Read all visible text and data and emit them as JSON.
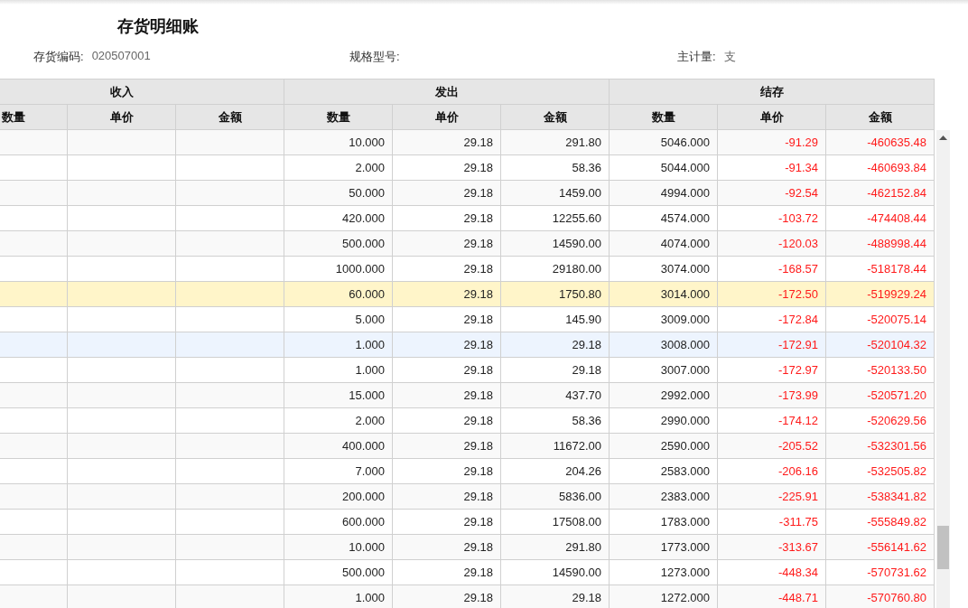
{
  "title": "存货明细账",
  "info": [
    {
      "label": "存货编码:",
      "value": "020507001"
    },
    {
      "label": "规格型号:"
    },
    {
      "label": "主计量:",
      "value": "支"
    }
  ],
  "groups": [
    "收入",
    "发出",
    "结存"
  ],
  "columns": [
    "数量",
    "单价",
    "金额",
    "数量",
    "单价",
    "金额",
    "数量",
    "单价",
    "金额"
  ],
  "rows": [
    {
      "issue": [
        "10.000",
        "29.18",
        "291.80"
      ],
      "balance": [
        "5046.000",
        "-91.29",
        "-460635.48"
      ],
      "selected": false,
      "hovered": false
    },
    {
      "issue": [
        "2.000",
        "29.18",
        "58.36"
      ],
      "balance": [
        "5044.000",
        "-91.34",
        "-460693.84"
      ],
      "selected": false,
      "hovered": false
    },
    {
      "issue": [
        "50.000",
        "29.18",
        "1459.00"
      ],
      "balance": [
        "4994.000",
        "-92.54",
        "-462152.84"
      ],
      "selected": false,
      "hovered": false
    },
    {
      "issue": [
        "420.000",
        "29.18",
        "12255.60"
      ],
      "balance": [
        "4574.000",
        "-103.72",
        "-474408.44"
      ],
      "selected": false,
      "hovered": false
    },
    {
      "issue": [
        "500.000",
        "29.18",
        "14590.00"
      ],
      "balance": [
        "4074.000",
        "-120.03",
        "-488998.44"
      ],
      "selected": false,
      "hovered": false
    },
    {
      "issue": [
        "1000.000",
        "29.18",
        "29180.00"
      ],
      "balance": [
        "3074.000",
        "-168.57",
        "-518178.44"
      ],
      "selected": false,
      "hovered": false
    },
    {
      "issue": [
        "60.000",
        "29.18",
        "1750.80"
      ],
      "balance": [
        "3014.000",
        "-172.50",
        "-519929.24"
      ],
      "selected": true,
      "hovered": false
    },
    {
      "issue": [
        "5.000",
        "29.18",
        "145.90"
      ],
      "balance": [
        "3009.000",
        "-172.84",
        "-520075.14"
      ],
      "selected": false,
      "hovered": false
    },
    {
      "issue": [
        "1.000",
        "29.18",
        "29.18"
      ],
      "balance": [
        "3008.000",
        "-172.91",
        "-520104.32"
      ],
      "selected": false,
      "hovered": true
    },
    {
      "issue": [
        "1.000",
        "29.18",
        "29.18"
      ],
      "balance": [
        "3007.000",
        "-172.97",
        "-520133.50"
      ],
      "selected": false,
      "hovered": false
    },
    {
      "issue": [
        "15.000",
        "29.18",
        "437.70"
      ],
      "balance": [
        "2992.000",
        "-173.99",
        "-520571.20"
      ],
      "selected": false,
      "hovered": false
    },
    {
      "issue": [
        "2.000",
        "29.18",
        "58.36"
      ],
      "balance": [
        "2990.000",
        "-174.12",
        "-520629.56"
      ],
      "selected": false,
      "hovered": false
    },
    {
      "issue": [
        "400.000",
        "29.18",
        "11672.00"
      ],
      "balance": [
        "2590.000",
        "-205.52",
        "-532301.56"
      ],
      "selected": false,
      "hovered": false
    },
    {
      "issue": [
        "7.000",
        "29.18",
        "204.26"
      ],
      "balance": [
        "2583.000",
        "-206.16",
        "-532505.82"
      ],
      "selected": false,
      "hovered": false
    },
    {
      "issue": [
        "200.000",
        "29.18",
        "5836.00"
      ],
      "balance": [
        "2383.000",
        "-225.91",
        "-538341.82"
      ],
      "selected": false,
      "hovered": false
    },
    {
      "issue": [
        "600.000",
        "29.18",
        "17508.00"
      ],
      "balance": [
        "1783.000",
        "-311.75",
        "-555849.82"
      ],
      "selected": false,
      "hovered": false
    },
    {
      "issue": [
        "10.000",
        "29.18",
        "291.80"
      ],
      "balance": [
        "1773.000",
        "-313.67",
        "-556141.62"
      ],
      "selected": false,
      "hovered": false
    },
    {
      "issue": [
        "500.000",
        "29.18",
        "14590.00"
      ],
      "balance": [
        "1273.000",
        "-448.34",
        "-570731.62"
      ],
      "selected": false,
      "hovered": false
    },
    {
      "issue": [
        "1.000",
        "29.18",
        "29.18"
      ],
      "balance": [
        "1272.000",
        "-448.71",
        "-570760.80"
      ],
      "selected": false,
      "hovered": false
    }
  ]
}
